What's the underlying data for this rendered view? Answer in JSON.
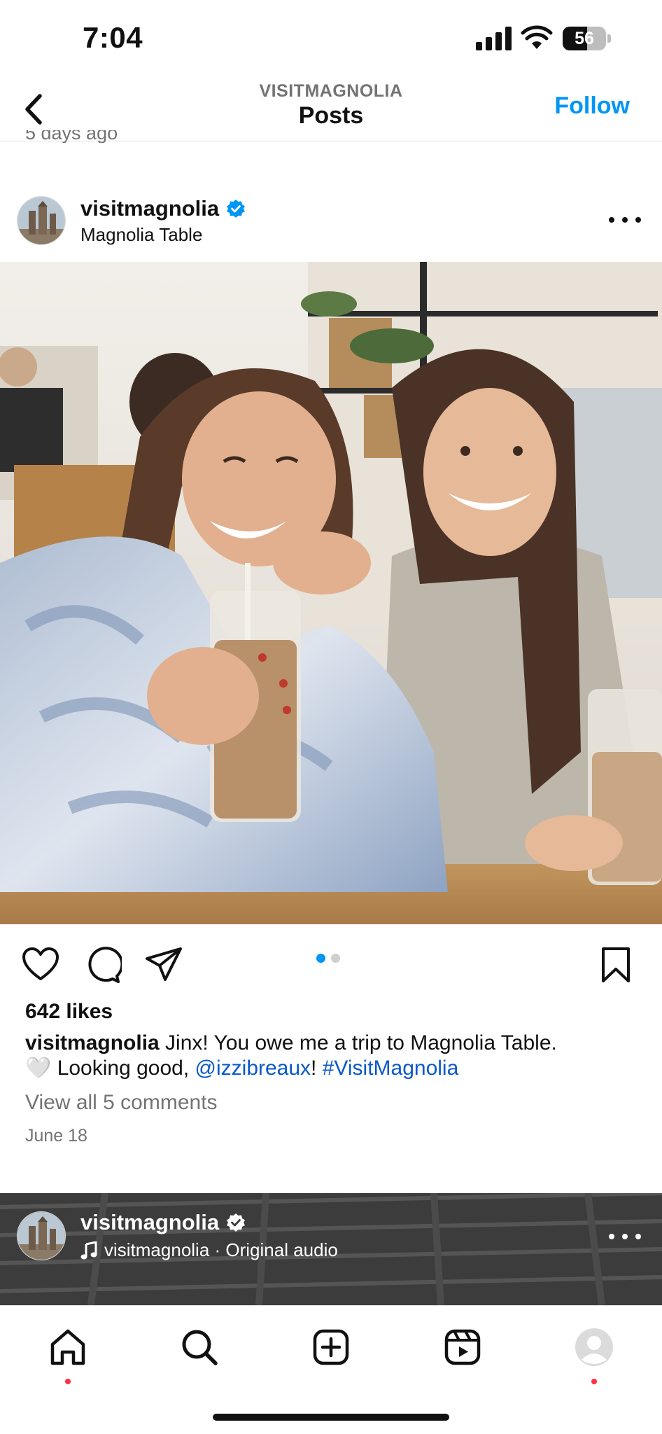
{
  "status_bar": {
    "time": "7:04",
    "battery": "56",
    "battery_level": 0.56,
    "icons": [
      "signal-icon",
      "wifi-icon",
      "battery-icon"
    ]
  },
  "header": {
    "account": "VISITMAGNOLIA",
    "title": "Posts",
    "follow_label": "Follow",
    "back_icon": "chevron-left-icon"
  },
  "previous_post": {
    "time": "5 days ago"
  },
  "post": {
    "username": "visitmagnolia",
    "location": "Magnolia Table",
    "likes": "642 likes",
    "caption": {
      "username": "visitmagnolia",
      "text_1": " Jinx! You owe me a trip to Magnolia Table.",
      "text_2": "🤍 Looking good, ",
      "mention": "@izzibreaux",
      "text_3": "! ",
      "hashtag": "#VisitMagnolia"
    },
    "view_comments": "View all 5 comments",
    "date": "June 18",
    "carousel": {
      "current": 1,
      "total": 2
    }
  },
  "next_post": {
    "username": "visitmagnolia",
    "audio": "visitmagnolia · Original audio"
  },
  "colors": {
    "accent": "#0095f6",
    "secondary_text": "#737373",
    "notification": "#ff3040"
  }
}
